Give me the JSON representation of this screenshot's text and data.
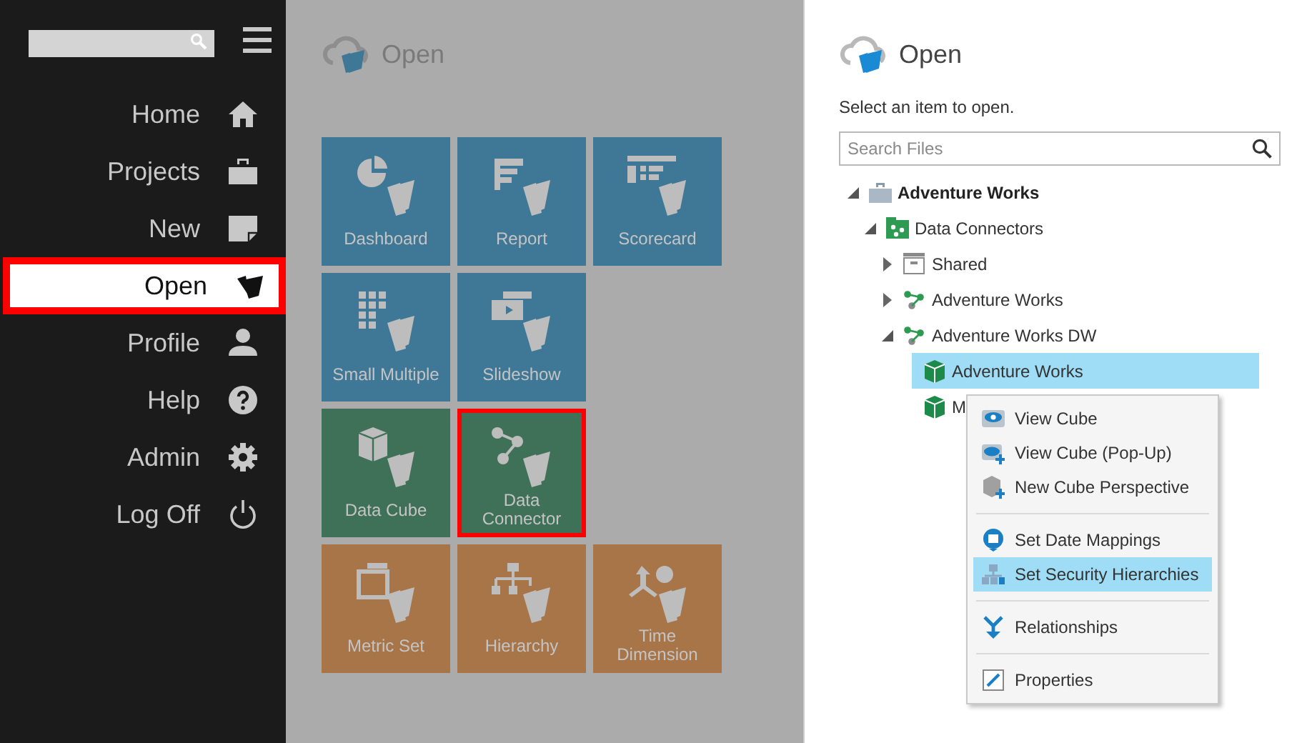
{
  "sidebar": {
    "items": [
      {
        "label": "Home",
        "kind": "home",
        "selected": false
      },
      {
        "label": "Projects",
        "kind": "projects",
        "selected": false
      },
      {
        "label": "New",
        "kind": "new",
        "selected": false
      },
      {
        "label": "Open",
        "kind": "open",
        "selected": true
      },
      {
        "label": "Profile",
        "kind": "profile",
        "selected": false
      },
      {
        "label": "Help",
        "kind": "help",
        "selected": false
      },
      {
        "label": "Admin",
        "kind": "admin",
        "selected": false
      },
      {
        "label": "Log Off",
        "kind": "logoff",
        "selected": false
      }
    ]
  },
  "gallery": {
    "title": "Open",
    "rows": [
      [
        {
          "label": "Dashboard",
          "kind": "dashboard",
          "color": "#3f7896",
          "selected": false
        },
        {
          "label": "Report",
          "kind": "report",
          "color": "#3f7896",
          "selected": false
        },
        {
          "label": "Scorecard",
          "kind": "scorecard",
          "color": "#3f7896",
          "selected": false
        }
      ],
      [
        {
          "label": "Small Multiple",
          "kind": "grid",
          "color": "#3f7896",
          "selected": false
        },
        {
          "label": "Slideshow",
          "kind": "slideshow",
          "color": "#3f7896",
          "selected": false
        }
      ],
      [
        {
          "label": "Data Cube",
          "kind": "cube",
          "color": "#3f7158",
          "selected": false
        },
        {
          "label": "Data Connector",
          "kind": "connector",
          "color": "#3f7158",
          "selected": true
        }
      ],
      [
        {
          "label": "Metric Set",
          "kind": "metric",
          "color": "#a77548",
          "selected": false
        },
        {
          "label": "Hierarchy",
          "kind": "hierarchy",
          "color": "#a77548",
          "selected": false
        },
        {
          "label": "Time Dimension",
          "kind": "time",
          "color": "#a77548",
          "selected": false
        }
      ]
    ]
  },
  "panel": {
    "title": "Open",
    "prompt": "Select an item to open.",
    "search": {
      "placeholder": "Search Files"
    },
    "tree": [
      {
        "label": "Adventure Works",
        "kind": "project",
        "expanded": true,
        "selected": false,
        "children": [
          {
            "label": "Data Connectors",
            "kind": "connectors",
            "expanded": true,
            "selected": false,
            "children": [
              {
                "label": "Shared",
                "kind": "shared",
                "expanded": false,
                "selected": false
              },
              {
                "label": "Adventure Works",
                "kind": "connector",
                "expanded": false,
                "selected": false
              },
              {
                "label": "Adventure Works DW",
                "kind": "connector",
                "expanded": true,
                "selected": false,
                "children": [
                  {
                    "label": "Adventure Works",
                    "kind": "cube",
                    "selected": true
                  },
                  {
                    "label": "M",
                    "kind": "cube",
                    "selected": false
                  }
                ]
              }
            ]
          }
        ]
      }
    ]
  },
  "context_menu": {
    "groups": [
      [
        {
          "label": "View Cube",
          "kind": "view",
          "selected": false
        },
        {
          "label": "View Cube (Pop-Up)",
          "kind": "popup",
          "selected": false
        },
        {
          "label": "New Cube Perspective",
          "kind": "perspective",
          "selected": false
        }
      ],
      [
        {
          "label": "Set Date Mappings",
          "kind": "date",
          "selected": false
        },
        {
          "label": "Set Security Hierarchies",
          "kind": "security",
          "selected": true
        }
      ],
      [
        {
          "label": "Relationships",
          "kind": "relationships",
          "selected": false
        }
      ],
      [
        {
          "label": "Properties",
          "kind": "properties",
          "selected": false
        }
      ]
    ]
  }
}
